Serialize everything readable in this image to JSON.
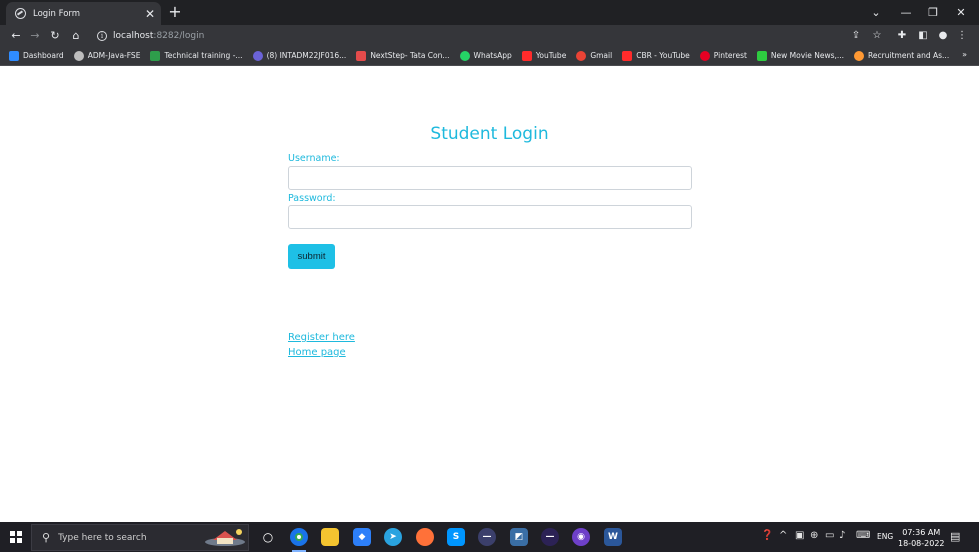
{
  "browser": {
    "tab": {
      "title": "Login Form"
    },
    "address": {
      "host": "localhost",
      "rest": ":8282/login"
    },
    "bookmarks": [
      {
        "label": "Dashboard",
        "color": "#2f8cff"
      },
      {
        "label": "ADM-Java-FSE",
        "color": "#bdbdbd"
      },
      {
        "label": "Technical training -...",
        "color": "#2e9d4b"
      },
      {
        "label": "(8) INTADM22JF016...",
        "color": "#6b63d8"
      },
      {
        "label": "NextStep- Tata Con...",
        "color": "#e44b4b"
      },
      {
        "label": "WhatsApp",
        "color": "#25d366"
      },
      {
        "label": "YouTube",
        "color": "#ff2b2b"
      },
      {
        "label": "Gmail",
        "color": "#ea4335"
      },
      {
        "label": "CBR - YouTube",
        "color": "#ff2b2b"
      },
      {
        "label": "Pinterest",
        "color": "#e60023"
      },
      {
        "label": "New Movie News,...",
        "color": "#2ecc40"
      },
      {
        "label": "Recruitment and As...",
        "color": "#ff9933"
      }
    ],
    "bookmarks_more": "»"
  },
  "login": {
    "title": "Student Login",
    "username_label": "Username:",
    "password_label": "Password:",
    "submit_label": "submit",
    "register_link": "Register here",
    "home_link": "Home page"
  },
  "taskbar": {
    "search_placeholder": "Type here to search",
    "language": "ENG",
    "time": "07:36 AM",
    "date": "18-08-2022"
  },
  "colors": {
    "accent": "#1eb9dd",
    "button": "#1ec0e6",
    "chrome_dark": "#202124",
    "chrome_toolbar": "#35363a",
    "taskbar": "#1f1f25"
  }
}
